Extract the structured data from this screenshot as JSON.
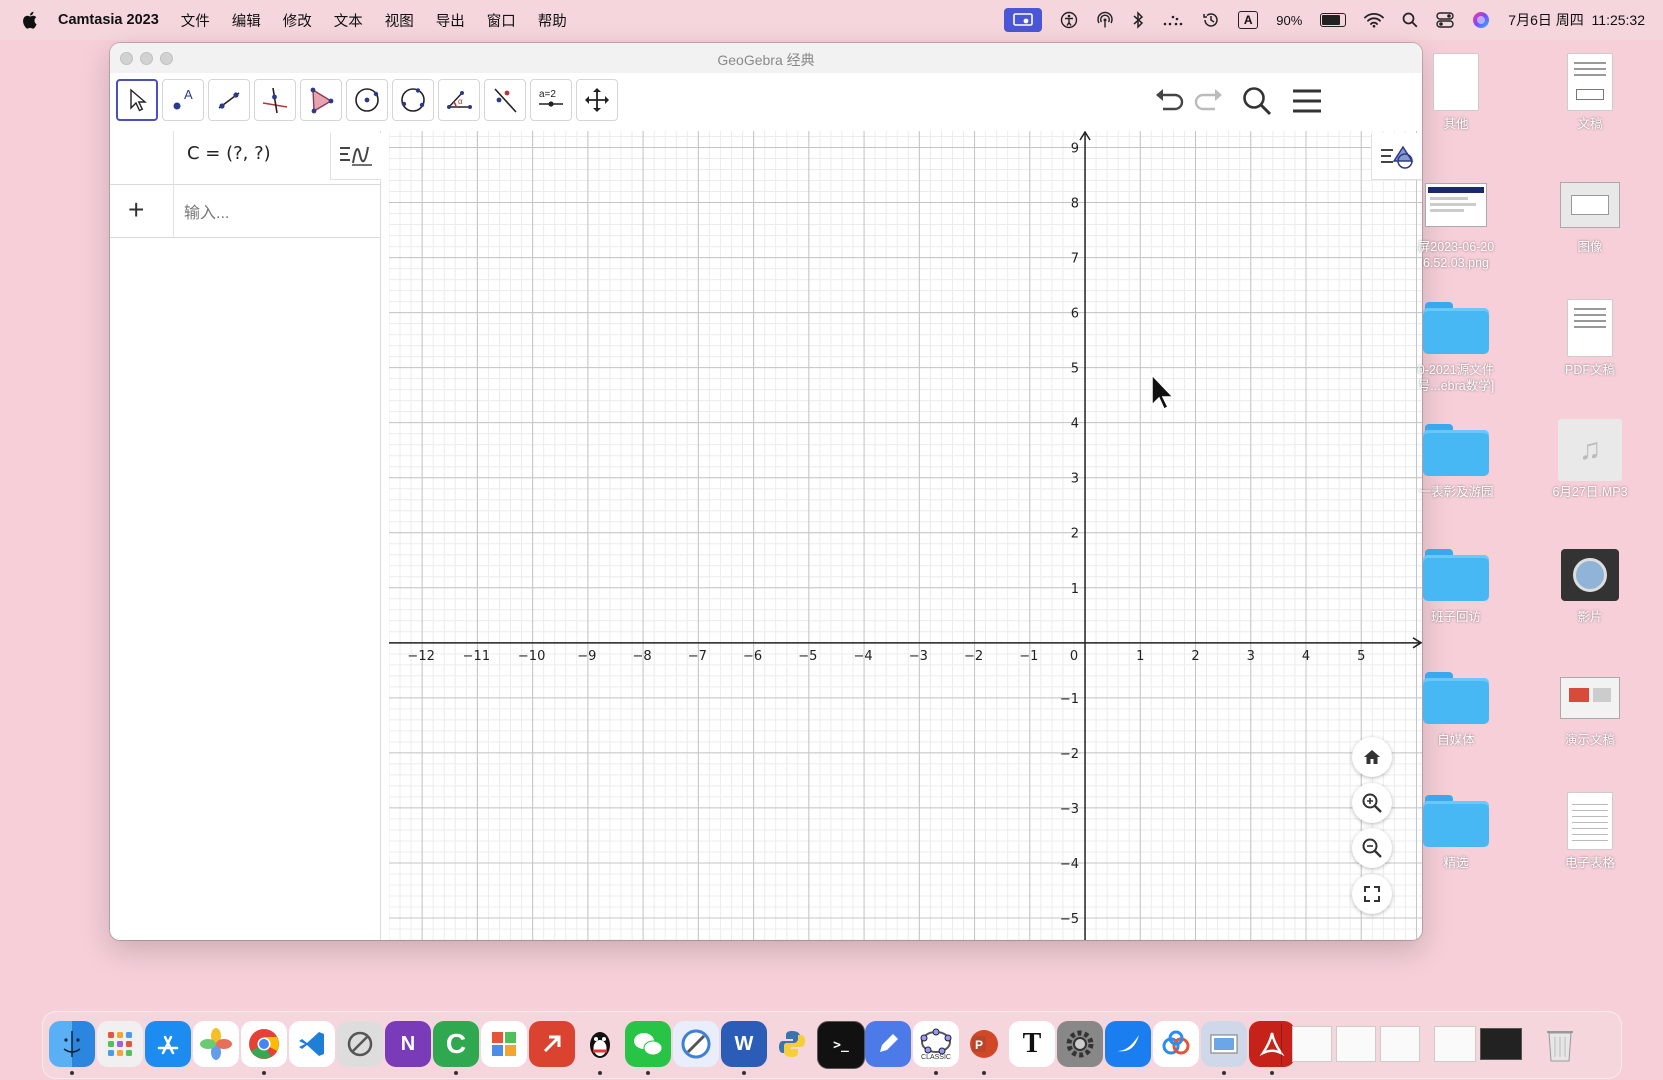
{
  "menubar": {
    "app_name": "Camtasia 2023",
    "menus": [
      "文件",
      "编辑",
      "修改",
      "文本",
      "视图",
      "导出",
      "窗口",
      "帮助"
    ],
    "battery_percent": "90%",
    "battery_level": 0.9,
    "input_source": "A",
    "datetime": "7月6日 周四  11:25:32"
  },
  "window": {
    "title": "GeoGebra 经典"
  },
  "toolbar": {
    "tools": [
      {
        "name": "move-tool",
        "icon": "arrow-cursor-icon",
        "active": true
      },
      {
        "name": "point-tool",
        "icon": "point-a-icon"
      },
      {
        "name": "line-tool",
        "icon": "line-icon"
      },
      {
        "name": "perpendicular-line-tool",
        "icon": "perpendicular-icon"
      },
      {
        "name": "polygon-tool",
        "icon": "triangle-icon"
      },
      {
        "name": "circle-tool",
        "icon": "circle-center-icon"
      },
      {
        "name": "circle-three-points-tool",
        "icon": "circle-three-points-icon"
      },
      {
        "name": "angle-tool",
        "icon": "angle-icon"
      },
      {
        "name": "reflect-tool",
        "icon": "reflect-icon"
      },
      {
        "name": "slider-tool",
        "icon": "slider-icon",
        "label": "a=2"
      },
      {
        "name": "move-graphics-tool",
        "icon": "move-graphics-icon"
      }
    ]
  },
  "algebra": {
    "rows": [
      {
        "expression": "C = (?, ?)"
      }
    ],
    "input_placeholder": "输入..."
  },
  "graphics": {
    "x_tick_labels": [
      "−12",
      "−11",
      "−10",
      "−9",
      "−8",
      "−7",
      "−6",
      "−5",
      "−4",
      "−3",
      "−2",
      "−1",
      "0",
      "1",
      "2",
      "3",
      "4",
      "5"
    ],
    "y_tick_labels": [
      "9",
      "8",
      "7",
      "6",
      "5",
      "4",
      "3",
      "2",
      "1",
      "−1",
      "−2",
      "−3",
      "−4",
      "−5"
    ],
    "x_range": [
      -12.6,
      6.1
    ],
    "y_range": [
      -5.4,
      9.3
    ],
    "grid": true,
    "buttons": [
      "home-icon",
      "zoom-in-icon",
      "zoom-out-icon",
      "fullscreen-icon"
    ]
  },
  "desktop": {
    "icons": [
      {
        "label": "其他",
        "type": "doc"
      },
      {
        "label": "文稿",
        "type": "doc"
      },
      {
        "label": "屏2023-06-20\n6.52.03.png",
        "type": "image"
      },
      {
        "label": "图像",
        "type": "image"
      },
      {
        "label": "0-2021源文件\n号...ebra数学]",
        "type": "folder"
      },
      {
        "label": "PDF文稿",
        "type": "doc"
      },
      {
        "label": "一表彰及游园",
        "type": "folder"
      },
      {
        "label": "6月27日.MP3",
        "type": "audio"
      },
      {
        "label": "班子回访",
        "type": "folder"
      },
      {
        "label": "影片",
        "type": "movie"
      },
      {
        "label": "自媒体",
        "type": "folder"
      },
      {
        "label": "演示文稿",
        "type": "doc"
      },
      {
        "label": "精选",
        "type": "folder"
      },
      {
        "label": "电子表格",
        "type": "doc"
      }
    ]
  },
  "dock": {
    "apps": [
      "Finder",
      "Launchpad",
      "App Store",
      "Photos",
      "Chrome",
      "VS Code",
      "Screenshot",
      "OneNote",
      "Camtasia",
      "Microsoft 365",
      "Remote",
      "QQ",
      "WeChat",
      "Safari",
      "Word",
      "Python",
      "Terminal",
      "Pencil",
      "GeoGebra",
      "PowerPoint",
      "Typora",
      "System Preferences",
      "Lark",
      "Baidu Netdisk",
      "Preview",
      "Acrobat",
      "Documents",
      "Downloads",
      "Trash"
    ],
    "classic_label": "CLASSIC"
  }
}
